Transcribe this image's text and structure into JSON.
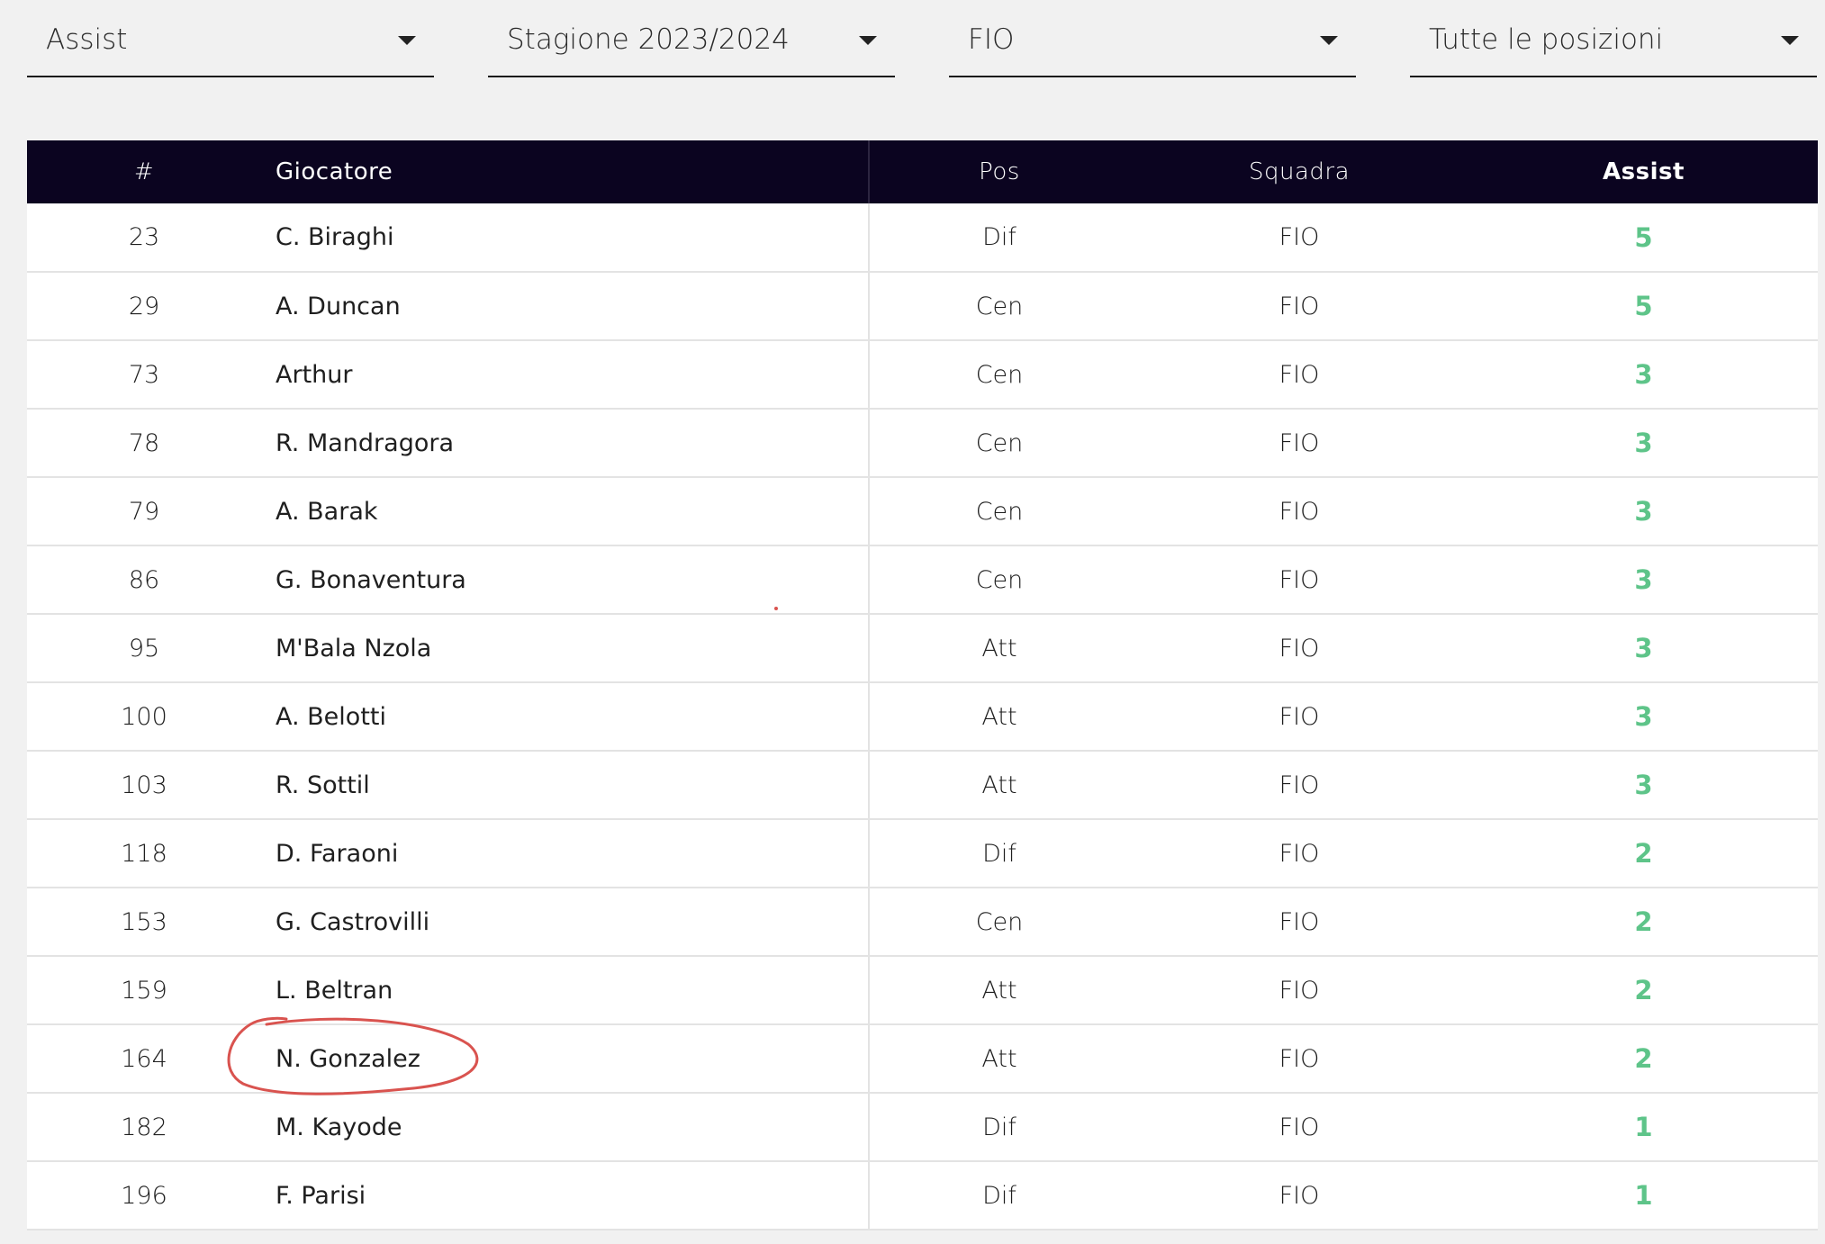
{
  "filters": [
    {
      "name": "stat",
      "value": "Assist"
    },
    {
      "name": "season",
      "value": "Stagione 2023/2024"
    },
    {
      "name": "team",
      "value": "FIO"
    },
    {
      "name": "position",
      "value": "Tutte le posizioni"
    }
  ],
  "table": {
    "headers": {
      "rank": "#",
      "player": "Giocatore",
      "pos": "Pos",
      "team": "Squadra",
      "assist": "Assist"
    },
    "rows": [
      {
        "rank": "23",
        "player": "C. Biraghi",
        "pos": "Dif",
        "team": "FIO",
        "assist": "5"
      },
      {
        "rank": "29",
        "player": "A. Duncan",
        "pos": "Cen",
        "team": "FIO",
        "assist": "5"
      },
      {
        "rank": "73",
        "player": "Arthur",
        "pos": "Cen",
        "team": "FIO",
        "assist": "3"
      },
      {
        "rank": "78",
        "player": "R. Mandragora",
        "pos": "Cen",
        "team": "FIO",
        "assist": "3"
      },
      {
        "rank": "79",
        "player": "A. Barak",
        "pos": "Cen",
        "team": "FIO",
        "assist": "3"
      },
      {
        "rank": "86",
        "player": "G. Bonaventura",
        "pos": "Cen",
        "team": "FIO",
        "assist": "3"
      },
      {
        "rank": "95",
        "player": "M'Bala Nzola",
        "pos": "Att",
        "team": "FIO",
        "assist": "3"
      },
      {
        "rank": "100",
        "player": "A. Belotti",
        "pos": "Att",
        "team": "FIO",
        "assist": "3"
      },
      {
        "rank": "103",
        "player": "R. Sottil",
        "pos": "Att",
        "team": "FIO",
        "assist": "3"
      },
      {
        "rank": "118",
        "player": "D. Faraoni",
        "pos": "Dif",
        "team": "FIO",
        "assist": "2"
      },
      {
        "rank": "153",
        "player": "G. Castrovilli",
        "pos": "Cen",
        "team": "FIO",
        "assist": "2"
      },
      {
        "rank": "159",
        "player": "L. Beltran",
        "pos": "Att",
        "team": "FIO",
        "assist": "2"
      },
      {
        "rank": "164",
        "player": "N. Gonzalez",
        "pos": "Att",
        "team": "FIO",
        "assist": "2"
      },
      {
        "rank": "182",
        "player": "M. Kayode",
        "pos": "Dif",
        "team": "FIO",
        "assist": "1"
      },
      {
        "rank": "196",
        "player": "F. Parisi",
        "pos": "Dif",
        "team": "FIO",
        "assist": "1"
      }
    ]
  },
  "highlighted_player": "N. Gonzalez",
  "colors": {
    "header_bg": "#0b0420",
    "assist_green": "#5ec489",
    "annotation_red": "#d9534f",
    "page_bg": "#f1f1f1"
  }
}
